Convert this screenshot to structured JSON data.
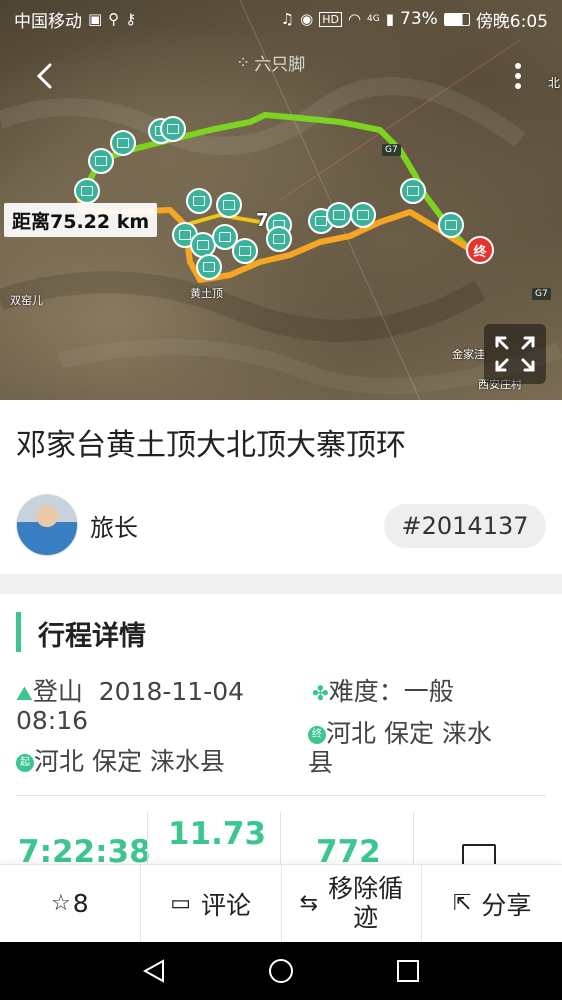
{
  "status_bar": {
    "carrier": "中国移动",
    "battery": "73%",
    "network": "4G",
    "time": "傍晚6:05",
    "hd_badge": "HD"
  },
  "watermark": "六只脚",
  "map": {
    "distance_label": "距离75.22 km",
    "places": {
      "shuangyao": "双窑儿",
      "huangtuding": "黄土顶",
      "jinjia": "金家洼",
      "xianzhuang": "西安庄村",
      "north": "北"
    },
    "highways": [
      "G7",
      "G7"
    ],
    "end_marker": "终",
    "hidden_fragment": "7"
  },
  "trip": {
    "title": "邓家台黄土顶大北顶大寨顶环",
    "author": "旅长",
    "id": "#2014137"
  },
  "section": {
    "title": "行程详情",
    "activity": "登山",
    "date": "2018-11-04",
    "time": "08:16",
    "start_location": "河北  保定  涞水县",
    "difficulty": "难度：一般",
    "end_location_1": "河北  保定  涞水",
    "end_location_2": "县",
    "start_badge": "起",
    "end_badge": "终"
  },
  "stats": {
    "duration": "7:22:38",
    "distance": "11.73",
    "ascent": "772"
  },
  "actions": {
    "star_count": "8",
    "comment": "评论",
    "remove_track_1": "移除循",
    "remove_track_2": "迹",
    "share": "分享"
  },
  "colors": {
    "accent": "#3cc68f",
    "route_green": "#7ed321",
    "route_orange": "#f5a623",
    "end_red": "#e8332b"
  }
}
